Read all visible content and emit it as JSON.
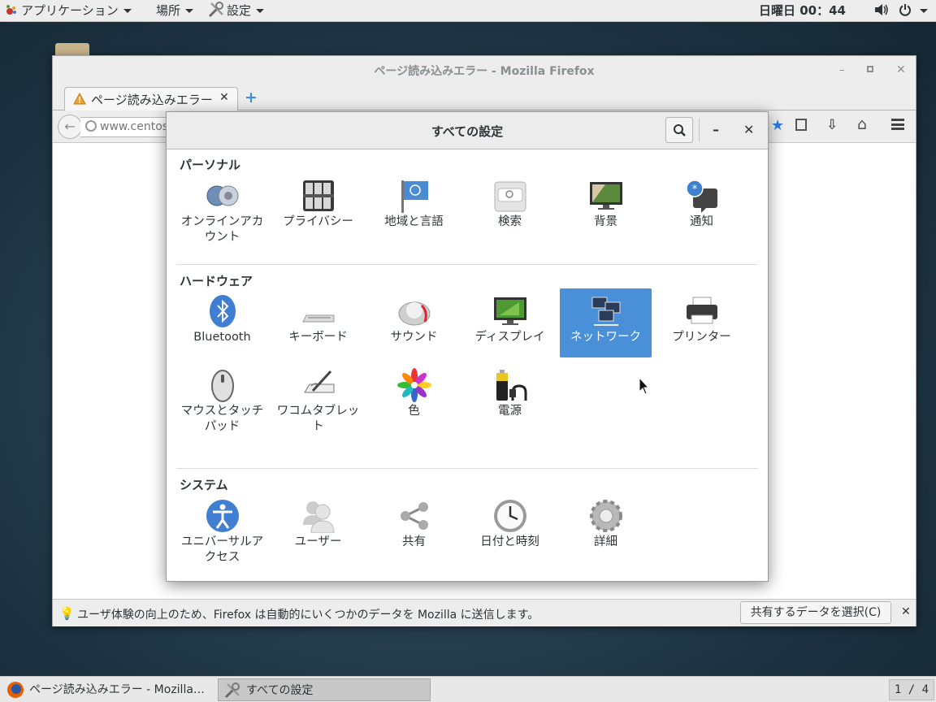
{
  "top_bar": {
    "applications": "アプリケーション",
    "places": "場所",
    "settings": "設定",
    "clock": "日曜日 00：44"
  },
  "firefox": {
    "title": "ページ読み込みエラー - Mozilla Firefox",
    "tab_label": "ページ読み込みエラー",
    "url": "www.centos",
    "notice_text": "ユーザ体験の向上のため、Firefox は自動的にいくつかのデータを Mozilla に送信します。",
    "notice_button": "共有するデータを選択(C)"
  },
  "settings": {
    "title": "すべての設定",
    "sections": {
      "personal": {
        "title": "パーソナル",
        "items": [
          "オンラインアカウント",
          "プライバシー",
          "地域と言語",
          "検索",
          "背景",
          "通知"
        ]
      },
      "hardware": {
        "title": "ハードウェア",
        "items": [
          "Bluetooth",
          "キーボード",
          "サウンド",
          "ディスプレイ",
          "ネットワーク",
          "プリンター",
          "マウスとタッチパッド",
          "ワコムタブレット",
          "色",
          "電源"
        ],
        "selected": "ネットワーク"
      },
      "system": {
        "title": "システム",
        "items": [
          "ユニバーサルアクセス",
          "ユーザー",
          "共有",
          "日付と時刻",
          "詳細"
        ]
      }
    }
  },
  "taskbar": {
    "items": [
      "ページ読み込みエラー - Mozilla…",
      "すべての設定"
    ],
    "workspace": "1 / 4"
  },
  "colors": {
    "accent": "#4a90d9",
    "topbar": "#ededed",
    "desktop": "#24404f"
  }
}
